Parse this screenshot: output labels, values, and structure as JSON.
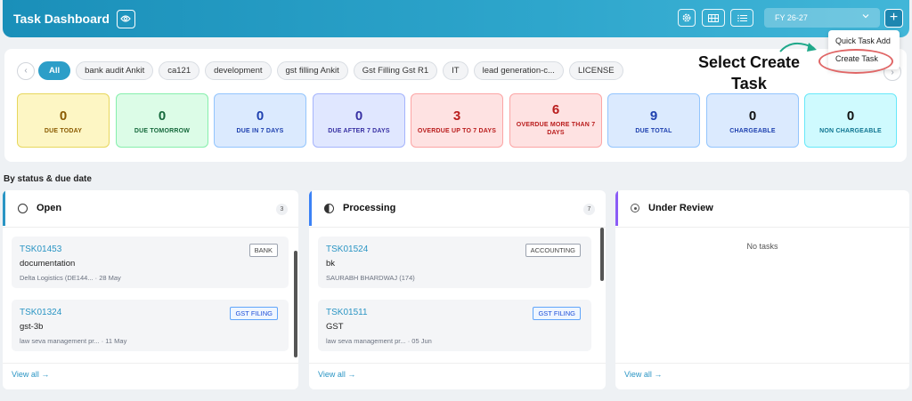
{
  "header": {
    "title": "Task Dashboard",
    "fy_value": "FY 26-27",
    "icons": [
      "eye-icon",
      "gear-icon",
      "grid-icon",
      "list-icon",
      "chevron-down-icon",
      "plus-icon"
    ]
  },
  "dropdown": {
    "items": [
      "Quick Task Add",
      "Create Task"
    ]
  },
  "annotation": "Select Create Task",
  "filters": {
    "chips": [
      "All",
      "bank audit Ankit",
      "ca121",
      "development",
      "gst filling Ankit",
      "Gst Filling Gst R1",
      "IT",
      "lead generation-c...",
      "LICENSE"
    ],
    "active": "All"
  },
  "stats": [
    {
      "value": "0",
      "label": "DUE TODAY"
    },
    {
      "value": "0",
      "label": "DUE TOMORROW"
    },
    {
      "value": "0",
      "label": "DUE IN 7 DAYS"
    },
    {
      "value": "0",
      "label": "DUE AFTER 7 DAYS"
    },
    {
      "value": "3",
      "label": "OVERDUE UP TO 7 DAYS"
    },
    {
      "value": "6",
      "label": "OVERDUE MORE THAN 7 DAYS"
    },
    {
      "value": "9",
      "label": "DUE TOTAL"
    },
    {
      "value": "0",
      "label": "CHARGEABLE"
    },
    {
      "value": "0",
      "label": "NON CHARGEABLE"
    }
  ],
  "section_title": "By status & due date",
  "columns": [
    {
      "name": "Open",
      "count": "3",
      "accent": "#2a95c4",
      "tasks": [
        {
          "id": "TSK01453",
          "tag": "BANK",
          "desc": "documentation",
          "meta": "Delta Logistics (DE144... · 28 May"
        },
        {
          "id": "TSK01324",
          "tag": "GST FILING",
          "desc": "gst-3b",
          "meta": "law seva management pr... · 11 May"
        }
      ],
      "view_all": "View all →"
    },
    {
      "name": "Processing",
      "count": "7",
      "accent": "#3b82f6",
      "tasks": [
        {
          "id": "TSK01524",
          "tag": "ACCOUNTING",
          "desc": "bk",
          "meta": "SAURABH BHARDWAJ (174)"
        },
        {
          "id": "TSK01511",
          "tag": "GST FILING",
          "desc": "GST",
          "meta": "law seva management pr... · 05 Jun"
        }
      ],
      "view_all": "View all →"
    },
    {
      "name": "Under Review",
      "accent": "#8b5cf6",
      "empty": "No tasks",
      "view_all": "View all →"
    }
  ]
}
